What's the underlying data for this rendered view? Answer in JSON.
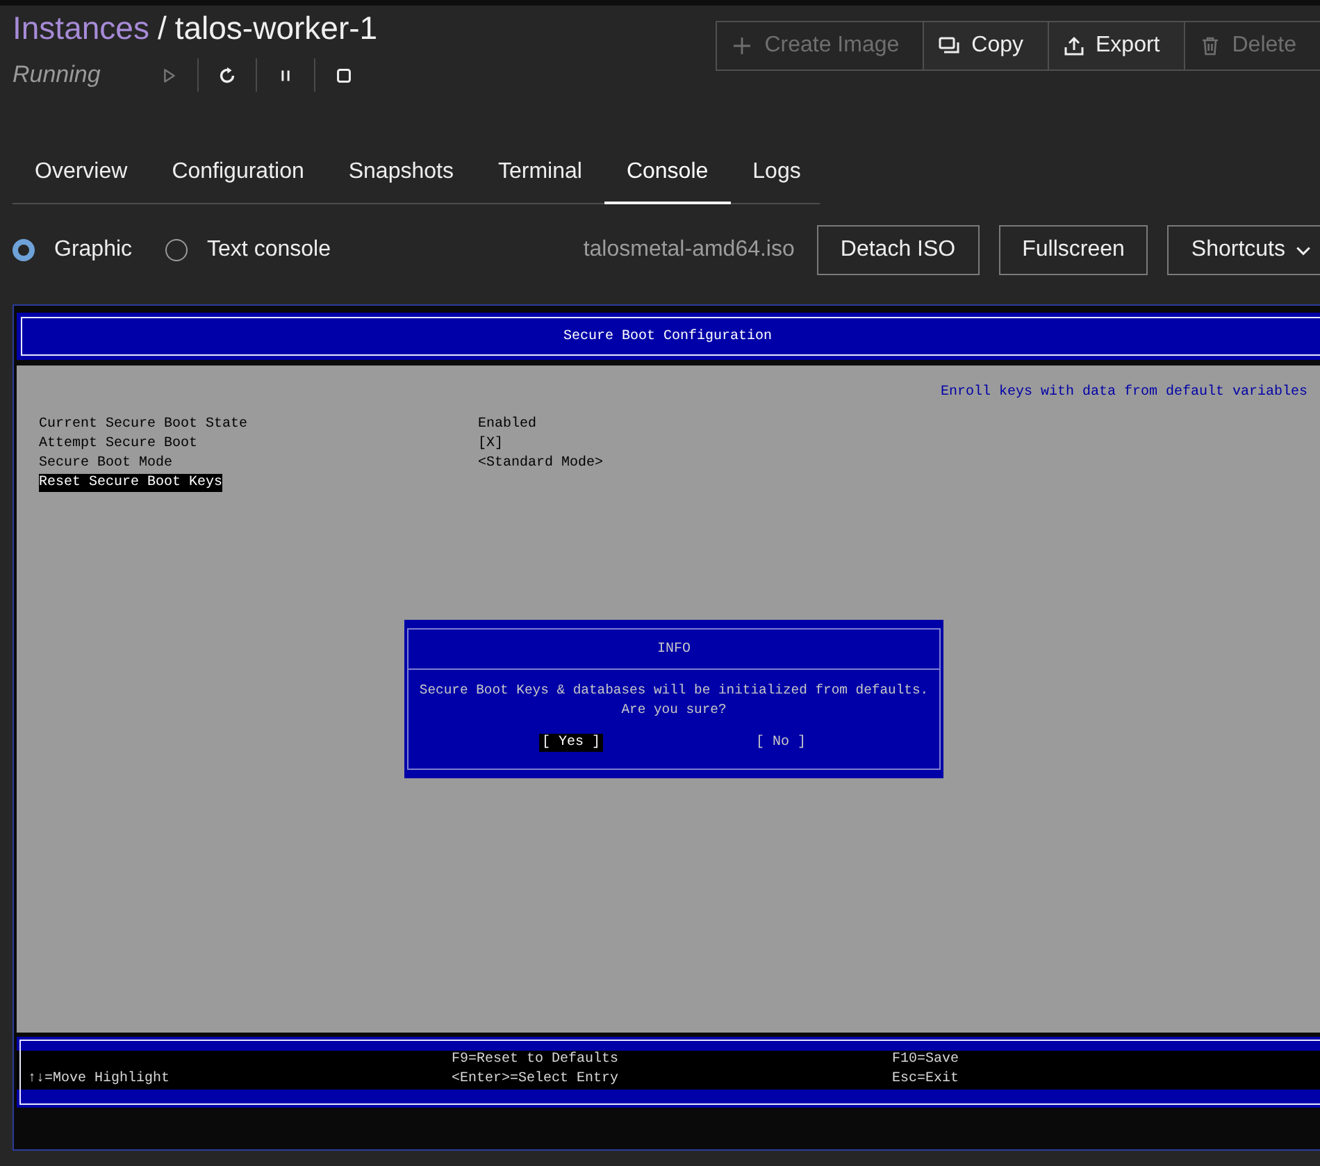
{
  "breadcrumb": {
    "parent": "Instances",
    "separator": "/",
    "current": "talos-worker-1"
  },
  "status": "Running",
  "controls": [
    {
      "kind": "start",
      "disabled": true
    },
    {
      "kind": "restart",
      "disabled": false
    },
    {
      "kind": "pause",
      "disabled": false
    },
    {
      "kind": "stop",
      "disabled": false
    }
  ],
  "actions": [
    {
      "kind": "create",
      "label": "Create Image",
      "disabled": true
    },
    {
      "kind": "copy",
      "label": "Copy",
      "disabled": false
    },
    {
      "kind": "export",
      "label": "Export",
      "disabled": false
    },
    {
      "kind": "delete",
      "label": "Delete",
      "disabled": true
    }
  ],
  "tabs": [
    {
      "label": "Overview",
      "selected": false
    },
    {
      "label": "Configuration",
      "selected": false
    },
    {
      "label": "Snapshots",
      "selected": false
    },
    {
      "label": "Terminal",
      "selected": false
    },
    {
      "label": "Console",
      "selected": true
    },
    {
      "label": "Logs",
      "selected": false
    }
  ],
  "console_modes": [
    {
      "label": "Graphic",
      "selected": true
    },
    {
      "label": "Text console",
      "selected": false
    }
  ],
  "iso": "talosmetal-amd64.iso",
  "console_buttons": [
    {
      "label": "Detach ISO",
      "dropdown": false
    },
    {
      "label": "Fullscreen",
      "dropdown": false
    },
    {
      "label": "Shortcuts",
      "dropdown": true
    }
  ],
  "screen": {
    "title": "Secure Boot Configuration",
    "help": "Enroll keys with data from default variables",
    "settings": [
      {
        "label": "Current Secure Boot State",
        "value": "Enabled",
        "selected": false
      },
      {
        "label": "Attempt Secure Boot",
        "value": "[X]",
        "selected": false
      },
      {
        "label": "Secure Boot Mode",
        "value": "<Standard Mode>",
        "selected": false
      },
      {
        "label": "Reset Secure Boot Keys",
        "selected": true
      }
    ],
    "dialog": {
      "title": "INFO",
      "message": [
        "Secure Boot Keys & databases will be initialized from defaults.",
        "Are you sure?"
      ],
      "buttons": [
        {
          "label": "[ Yes ]",
          "selected": true
        },
        {
          "label": "[ No ]",
          "selected": false
        }
      ]
    },
    "footer": [
      {
        "lines": [
          "↑↓=Move Highlight"
        ]
      },
      {
        "lines": [
          "F9=Reset to Defaults",
          "<Enter>=Select Entry"
        ]
      },
      {
        "lines": [
          "F10=Save",
          "Esc=Exit"
        ]
      }
    ]
  }
}
